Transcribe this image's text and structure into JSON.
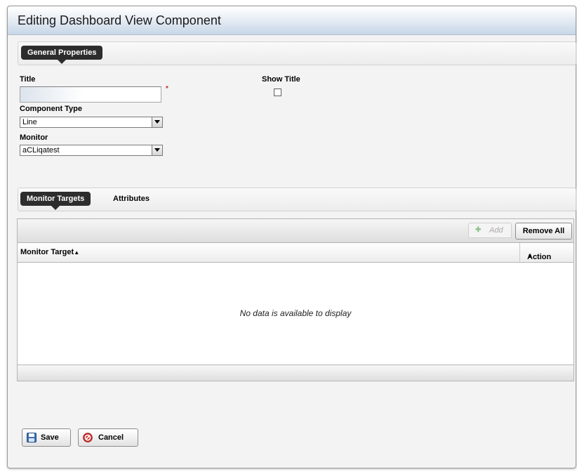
{
  "dialog": {
    "title": "Editing Dashboard View Component"
  },
  "general": {
    "tab_label": "General Properties",
    "title_label": "Title",
    "title_value": "",
    "required_marker": "*",
    "show_title_label": "Show Title",
    "show_title_checked": false,
    "component_type_label": "Component Type",
    "component_type_value": "Line",
    "monitor_label": "Monitor",
    "monitor_value": "aCLiqatest"
  },
  "tabs": {
    "active": "Monitor Targets",
    "other": "Attributes"
  },
  "grid": {
    "add_label": "Add",
    "remove_all_label": "Remove All",
    "columns": {
      "target": "Monitor Target",
      "action": "Action"
    },
    "sort_glyph": "▲",
    "empty_text": "No data is available to display"
  },
  "footer": {
    "save_label": "Save",
    "cancel_label": "Cancel"
  },
  "colors": {
    "tab_dark": "#2d2d2d",
    "title_bar": "#c7d6e8",
    "required": "#c0322b"
  }
}
